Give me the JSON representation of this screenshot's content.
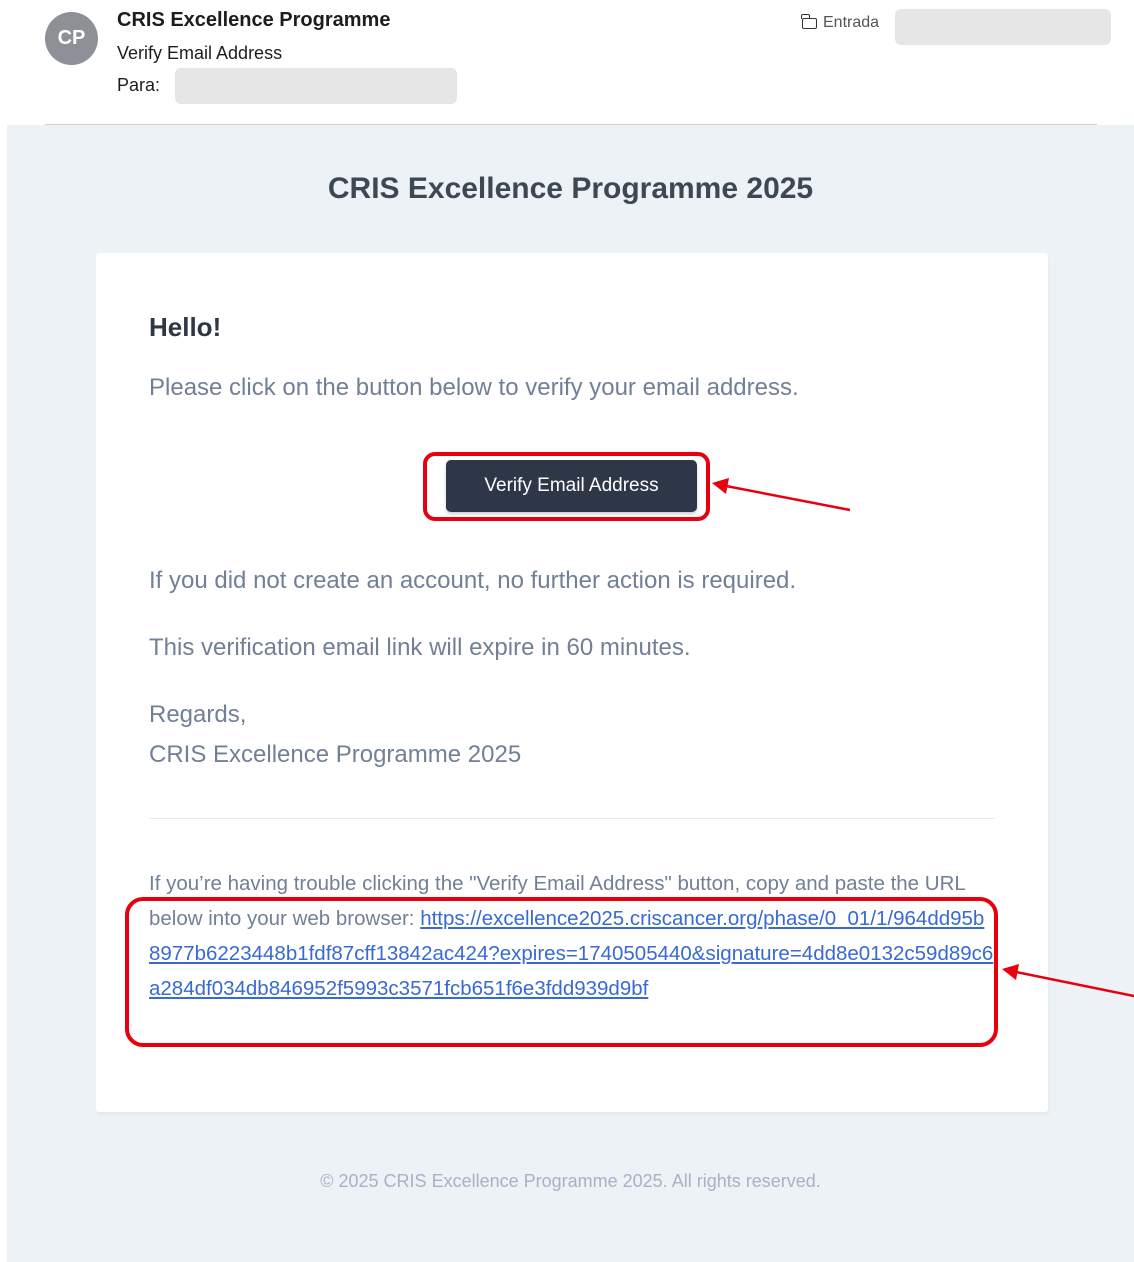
{
  "header": {
    "avatar_initials": "CP",
    "sender": "CRIS Excellence Programme",
    "subject": "Verify Email Address",
    "to_label": "Para:",
    "folder": "Entrada"
  },
  "email": {
    "brand": "CRIS Excellence Programme 2025",
    "greeting": "Hello!",
    "intro": "Please click on the button below to verify your email address.",
    "button_label": "Verify Email Address",
    "line_no_action": "If you did not create an account, no further action is required.",
    "line_expire": "This verification email link will expire in 60 minutes.",
    "salutation": "Regards,",
    "signature": "CRIS Excellence Programme 2025",
    "subcopy_text": "If you’re having trouble clicking the \"Verify Email Address\" button, copy and paste the URL below into your web browser: ",
    "url": "https://excellence2025.criscancer.org/phase/0_01/1/964dd95b8977b6223448b1fdf87cff13842ac424?expires=1740505440&signature=4dd8e0132c59d89c6a284df034db846952f5993c3571fcb651f6e3fdd939d9bf",
    "footer": "© 2025 CRIS Excellence Programme 2025. All rights reserved."
  },
  "colors": {
    "background": "#edf2f7",
    "button": "#2d3748",
    "link": "#3869d4",
    "annotation": "#e8000e"
  }
}
